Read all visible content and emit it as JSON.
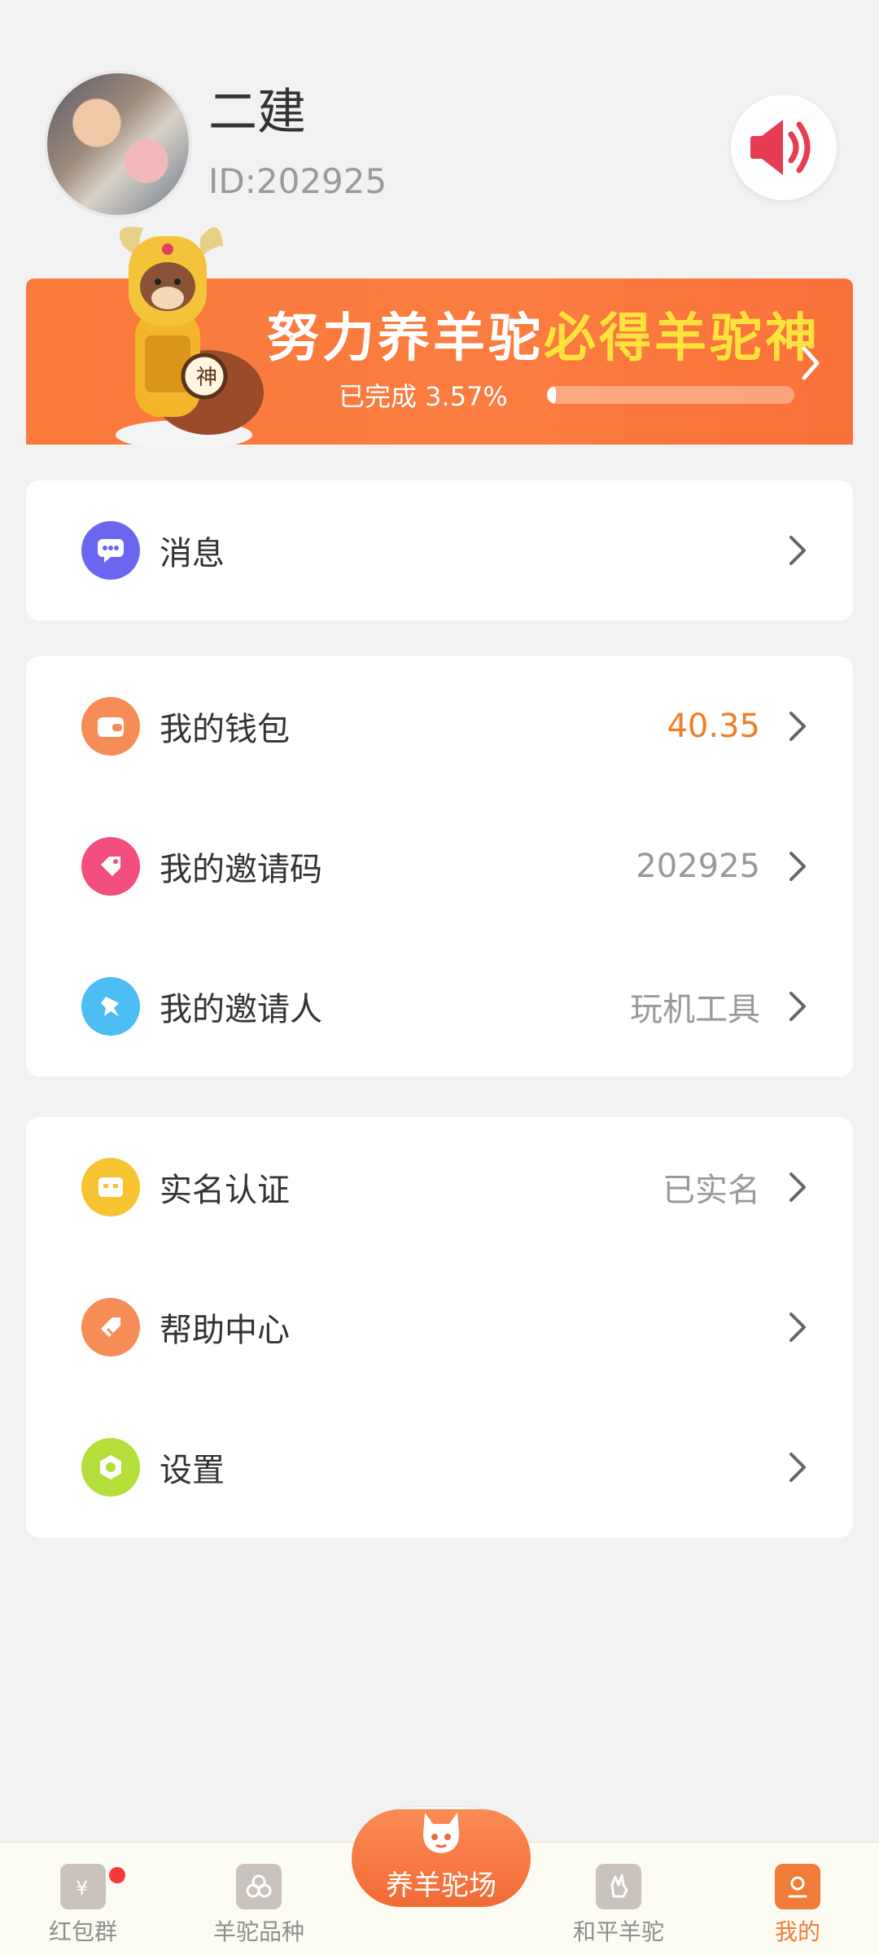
{
  "user": {
    "name": "二建",
    "id_text": "ID:202925"
  },
  "banner": {
    "title_part1": "努力养羊驼",
    "title_part2": "必得羊驼神",
    "progress_text": "已完成 3.57%",
    "progress_fraction": 0.0357
  },
  "card_messages": [
    {
      "label": "消息",
      "icon": "message-icon",
      "color": "#6b66f0"
    }
  ],
  "card_account": [
    {
      "label": "我的钱包",
      "value": "40.35",
      "icon": "wallet-icon",
      "color": "#f78d56"
    },
    {
      "label": "我的邀请码",
      "value": "202925",
      "icon": "tag-icon",
      "color": "#f24e7e"
    },
    {
      "label": "我的邀请人",
      "value": "玩机工具",
      "icon": "pin-icon",
      "color": "#4cbef3"
    }
  ],
  "card_settings": [
    {
      "label": "实名认证",
      "value": "已实名",
      "icon": "id-card-icon",
      "color": "#f7c431"
    },
    {
      "label": "帮助中心",
      "value": "",
      "icon": "help-icon",
      "color": "#f78d56"
    },
    {
      "label": "设置",
      "value": "",
      "icon": "settings-icon",
      "color": "#b4df3a"
    }
  ],
  "tabbar": {
    "items": [
      {
        "label": "红包群",
        "icon": "red-packet-icon"
      },
      {
        "label": "羊驼品种",
        "icon": "breeds-icon"
      },
      {
        "label": "养羊驼场",
        "icon": "alpaca-farm-icon"
      },
      {
        "label": "和平羊驼",
        "icon": "peace-hand-icon"
      },
      {
        "label": "我的",
        "icon": "profile-icon"
      }
    ],
    "active_index": 4
  },
  "colors": {
    "accent": "#f07c3a",
    "banner_bg": "#fa7a3c",
    "highlight_yellow": "#ffe33d"
  }
}
